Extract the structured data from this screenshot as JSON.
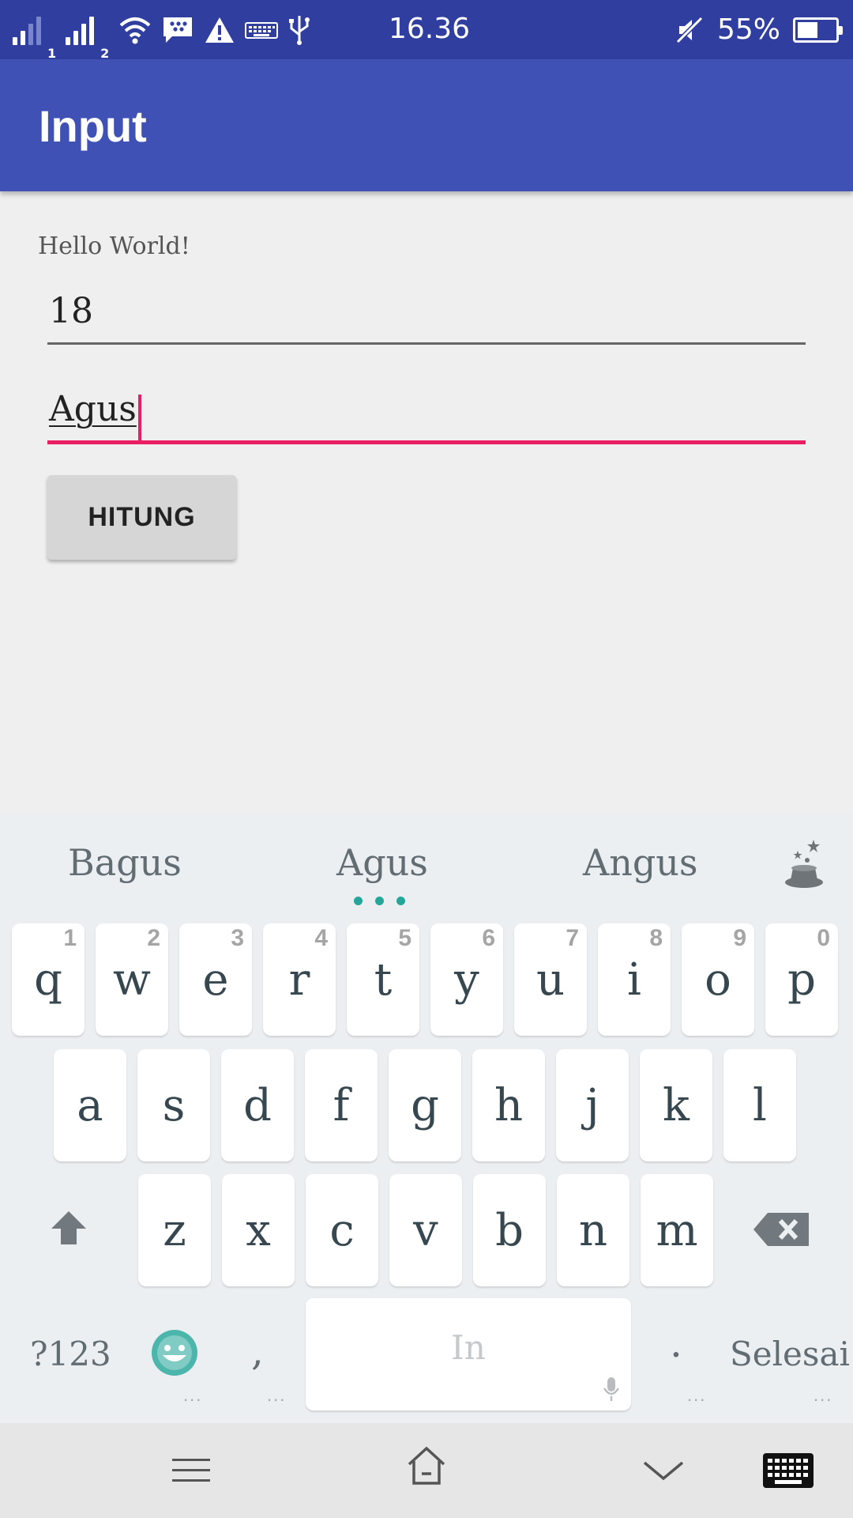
{
  "status_bar": {
    "sim1": "1",
    "sim2": "2",
    "time": "16.36",
    "battery_percent": "55%",
    "battery_level": 0.55,
    "icons": [
      "signal-sim1-icon",
      "signal-sim2-icon",
      "wifi-icon",
      "bbm-icon",
      "warning-icon",
      "keyboard-icon",
      "usb-icon",
      "mute-icon",
      "battery-icon"
    ]
  },
  "app_bar": {
    "title": "Input"
  },
  "main": {
    "hello_text": "Hello World!",
    "field1_value": "18",
    "field2_value": "Agus",
    "button_label": "HITUNG"
  },
  "keyboard": {
    "suggestions": [
      "Bagus",
      "Agus",
      "Angus"
    ],
    "row1": [
      {
        "key": "q",
        "hint": "1"
      },
      {
        "key": "w",
        "hint": "2"
      },
      {
        "key": "e",
        "hint": "3"
      },
      {
        "key": "r",
        "hint": "4"
      },
      {
        "key": "t",
        "hint": "5"
      },
      {
        "key": "y",
        "hint": "6"
      },
      {
        "key": "u",
        "hint": "7"
      },
      {
        "key": "i",
        "hint": "8"
      },
      {
        "key": "o",
        "hint": "9"
      },
      {
        "key": "p",
        "hint": "0"
      }
    ],
    "row2": [
      "a",
      "s",
      "d",
      "f",
      "g",
      "h",
      "j",
      "k",
      "l"
    ],
    "row3": [
      "z",
      "x",
      "c",
      "v",
      "b",
      "n",
      "m"
    ],
    "symbols_label": "?123",
    "comma_label": ",",
    "space_label": "In",
    "period_label": ".",
    "done_label": "Selesai",
    "more_dots": "..."
  },
  "colors": {
    "status_bar": "#303F9F",
    "app_bar": "#3F51B5",
    "accent": "#E91E63",
    "suggestion_dots": "#26A69A"
  },
  "nav_bar": {
    "icons": [
      "menu-icon",
      "home-icon",
      "chevron-down-icon",
      "keyboard-switch-icon"
    ]
  }
}
